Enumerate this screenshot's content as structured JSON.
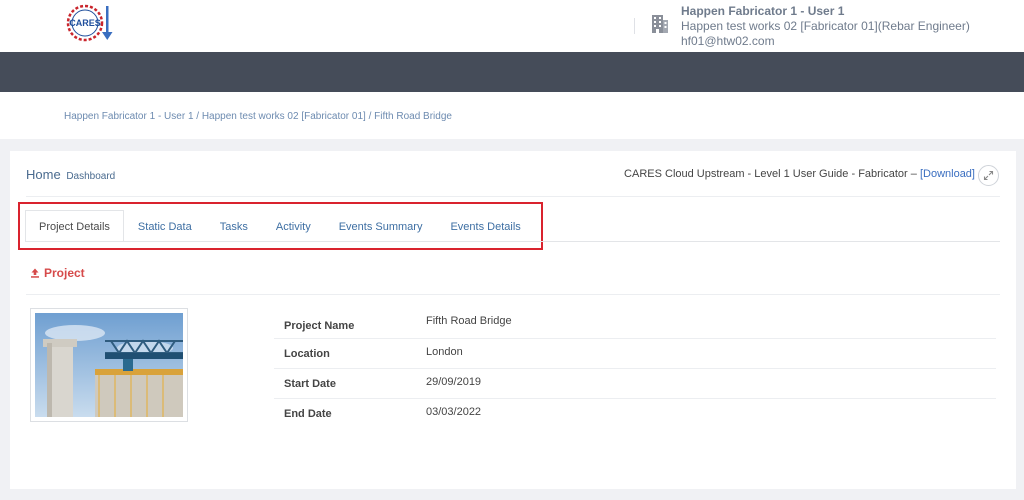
{
  "header": {
    "logo_text": "CARES",
    "user_name": "Happen Fabricator 1 - User 1",
    "user_role": "Happen test works 02 [Fabricator 01](Rebar Engineer)",
    "user_email": "hf01@htw02.com"
  },
  "breadcrumb": "Happen Fabricator 1 - User 1 / Happen test works 02 [Fabricator 01] / Fifth Road Bridge",
  "panel": {
    "title": "Home",
    "subtitle": "Dashboard",
    "guide_text": "CARES Cloud Upstream - Level 1 User Guide - Fabricator –",
    "download_label": "[Download]"
  },
  "tabs": [
    {
      "label": "Project Details",
      "active": true
    },
    {
      "label": "Static Data"
    },
    {
      "label": "Tasks"
    },
    {
      "label": "Activity"
    },
    {
      "label": "Events Summary"
    },
    {
      "label": "Events Details"
    }
  ],
  "section": {
    "title": "Project"
  },
  "details": [
    {
      "label": "Project Name",
      "value": "Fifth Road Bridge"
    },
    {
      "label": "Location",
      "value": "London"
    },
    {
      "label": "Start Date",
      "value": "29/09/2019"
    },
    {
      "label": "End Date",
      "value": "03/03/2022"
    }
  ],
  "colors": {
    "accent_red": "#d64a4a",
    "highlight_box": "#d9232e",
    "link_blue": "#3e6fa3",
    "dark_band": "#454c59"
  }
}
